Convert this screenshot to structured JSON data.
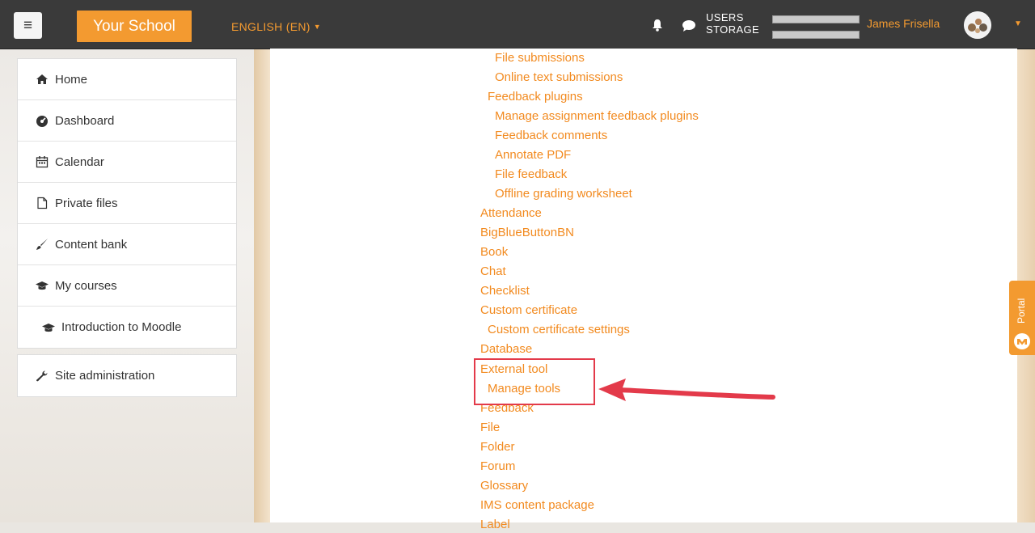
{
  "navbar": {
    "menu_icon": "hamburger-icon",
    "brand": "Your School",
    "language": "ENGLISH (EN)",
    "bell_icon": "bell-icon",
    "message_icon": "chat-bubble-icon",
    "users_label": "USERS",
    "storage_label": "STORAGE",
    "users_usage": 0.0,
    "storage_usage": 0.0,
    "user_name": "James Frisella",
    "avatar_icon": "avatar-image"
  },
  "sidebar": {
    "items": [
      {
        "label": "Home",
        "icon": "home-icon"
      },
      {
        "label": "Dashboard",
        "icon": "dashboard-icon"
      },
      {
        "label": "Calendar",
        "icon": "calendar-icon"
      },
      {
        "label": "Private files",
        "icon": "file-icon"
      },
      {
        "label": "Content bank",
        "icon": "paintbrush-icon"
      },
      {
        "label": "My courses",
        "icon": "graduation-cap-icon"
      },
      {
        "label": "Introduction to Moodle",
        "icon": "graduation-cap-icon"
      }
    ],
    "admin": {
      "label": "Site administration",
      "icon": "wrench-icon"
    }
  },
  "main": {
    "tree": [
      "File submissions",
      "Online text submissions",
      "Feedback plugins",
      "Manage assignment feedback plugins",
      "Feedback comments",
      "Annotate PDF",
      "File feedback",
      "Offline grading worksheet",
      "Attendance",
      "BigBlueButtonBN",
      "Book",
      "Chat",
      "Checklist",
      "Custom certificate",
      "Custom certificate settings",
      "Database",
      "External tool",
      "Manage tools",
      "Feedback",
      "File",
      "Folder",
      "Forum",
      "Glossary",
      "IMS content package",
      "Label"
    ]
  },
  "portal": {
    "label": "Portal",
    "icon": "cloud-m-icon"
  },
  "colors": {
    "accent": "#f39a30",
    "link": "#f28a1f",
    "navbar": "#3a3a3a",
    "annotation": "#e33a4a"
  }
}
